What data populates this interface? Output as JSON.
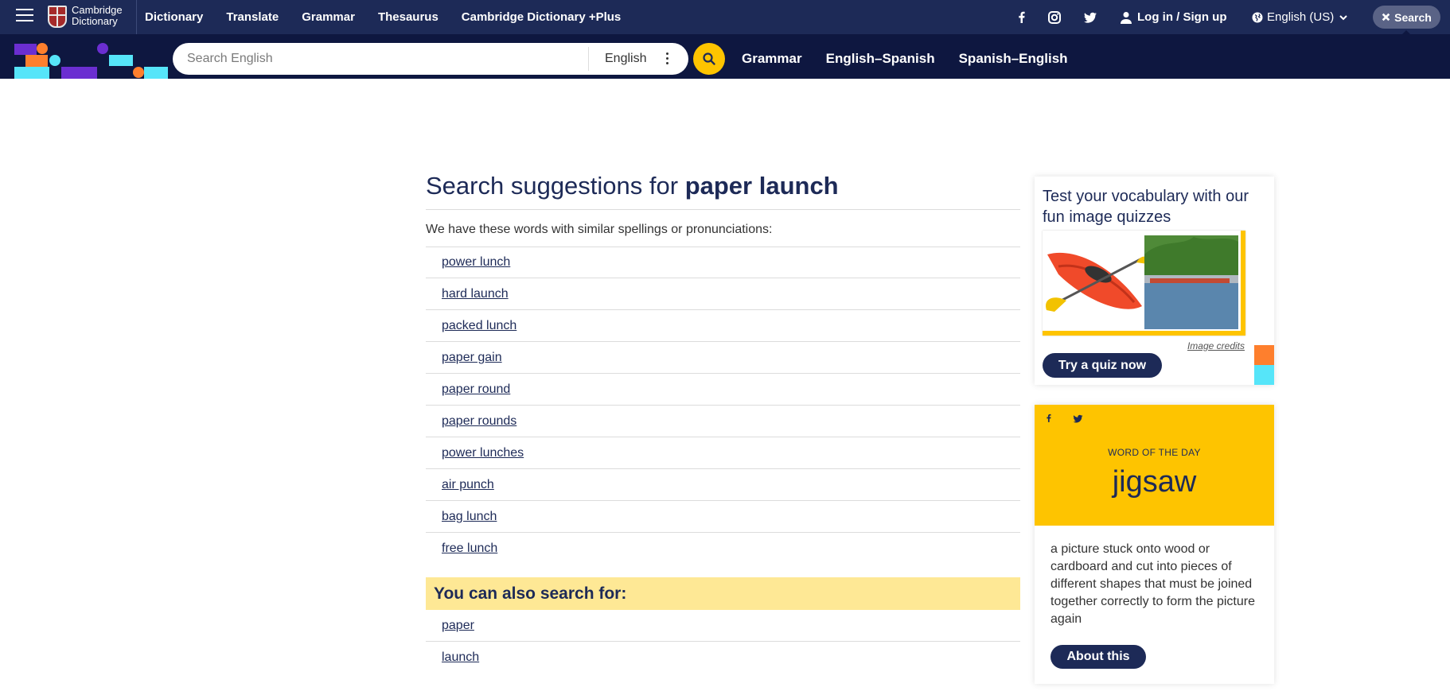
{
  "brand": {
    "line1": "Cambridge",
    "line2": "Dictionary"
  },
  "top_nav": [
    "Dictionary",
    "Translate",
    "Grammar",
    "Thesaurus",
    "Cambridge Dictionary +Plus"
  ],
  "header_right": {
    "login": "Log in / Sign up",
    "language": "English (US)",
    "search": "Search"
  },
  "search": {
    "placeholder": "Search English",
    "value": "",
    "dictionary": "English"
  },
  "sub_nav": [
    "Grammar",
    "English–Spanish",
    "Spanish–English"
  ],
  "results": {
    "heading_prefix": "Search suggestions for ",
    "query": "paper launch",
    "intro": "We have these words with similar spellings or pronunciations:",
    "suggestions": [
      "power lunch",
      "hard launch",
      "packed lunch",
      "paper gain",
      "paper round",
      "paper rounds",
      "power lunches",
      "air punch",
      "bag lunch",
      "free lunch"
    ],
    "also_heading": "You can also search for:",
    "also": [
      "paper",
      "launch"
    ]
  },
  "quiz": {
    "title": "Test your vocabulary with our fun image quizzes",
    "credits": "Image credits",
    "button": "Try a quiz now"
  },
  "wotd": {
    "label": "WORD OF THE DAY",
    "word": "jigsaw",
    "definition": "a picture stuck onto wood or cardboard and cut into pieces of different shapes that must be joined together correctly to form the picture again",
    "button": "About this"
  },
  "colors": {
    "navy": "#1d2a57",
    "dark_navy": "#0e1740",
    "yellow": "#fec400",
    "light_yellow": "#fee895",
    "orange": "#fe7f2d",
    "cyan": "#56e5f9",
    "purple": "#6b2ed1"
  }
}
